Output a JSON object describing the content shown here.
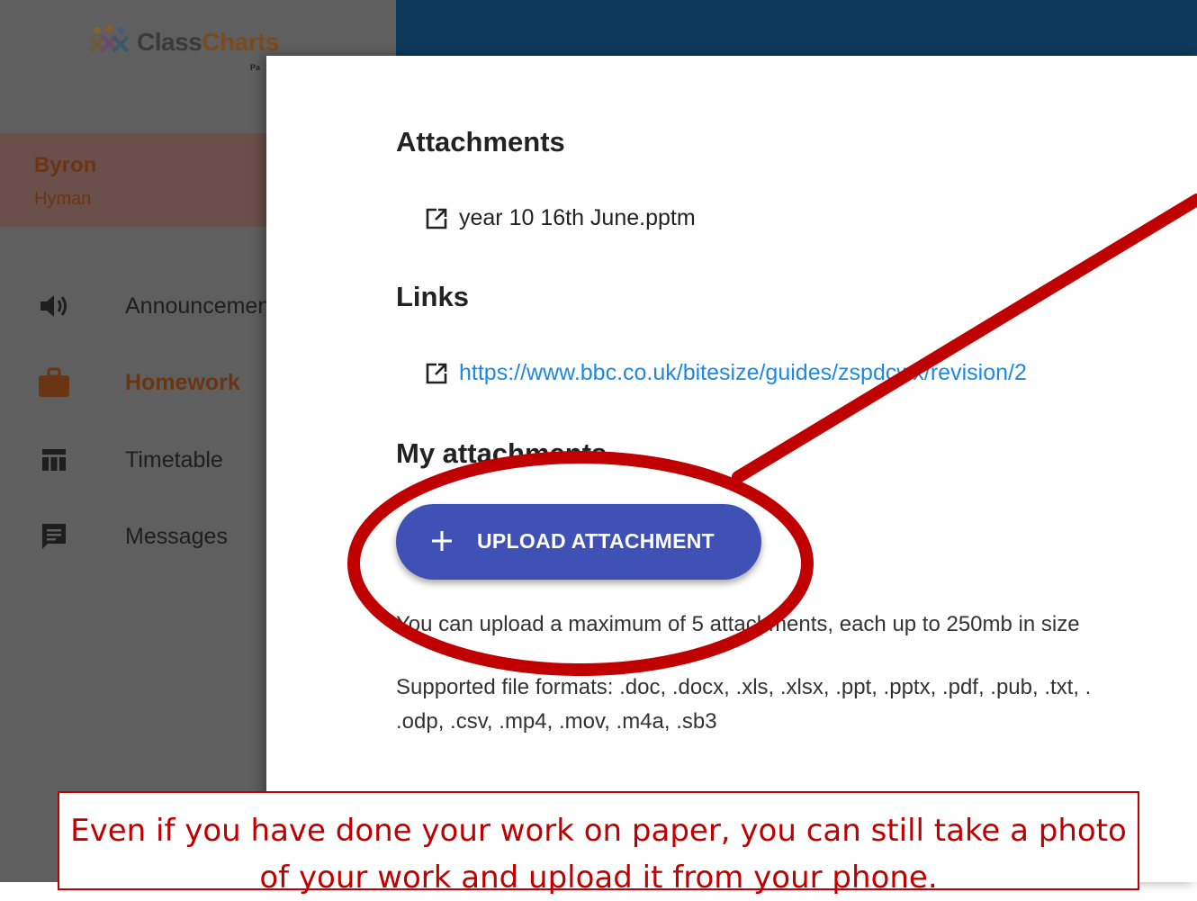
{
  "app": {
    "logo_text_main": "Class",
    "logo_text_accent": "Charts",
    "logo_sub": "Pa"
  },
  "profile": {
    "first_name": "Byron",
    "last_name": "Hyman"
  },
  "nav": {
    "items": [
      {
        "label": "Announcements",
        "icon": "speaker-icon",
        "active": false
      },
      {
        "label": "Homework",
        "icon": "briefcase-icon",
        "active": true
      },
      {
        "label": "Timetable",
        "icon": "timetable-icon",
        "active": false
      },
      {
        "label": "Messages",
        "icon": "message-icon",
        "active": false
      }
    ]
  },
  "modal": {
    "attachments_heading": "Attachments",
    "attachment_file": "year 10 16th June.pptm",
    "links_heading": "Links",
    "link_url": "https://www.bbc.co.uk/bitesize/guides/zspdcwx/revision/2",
    "my_attachments_heading": "My attachments",
    "upload_button_label": "UPLOAD ATTACHMENT",
    "limit_text": "You can upload a maximum of 5 attachments, each up to 250mb in size",
    "formats_line1": "Supported file formats: .doc, .docx, .xls, .xlsx, .ppt, .pptx, .pdf, .pub, .txt, .",
    "formats_line2": ".odp, .csv, .mp4, .mov, .m4a, .sb3"
  },
  "annotation": {
    "caption": "Even if you have done your work on paper, you can still take a photo of your work and upload it from your phone.",
    "color": "#c00000"
  },
  "colors": {
    "topbar": "#0f3a5e",
    "button": "#3f51b5",
    "link": "#1e88e5",
    "accent_brown": "#6a3513"
  }
}
